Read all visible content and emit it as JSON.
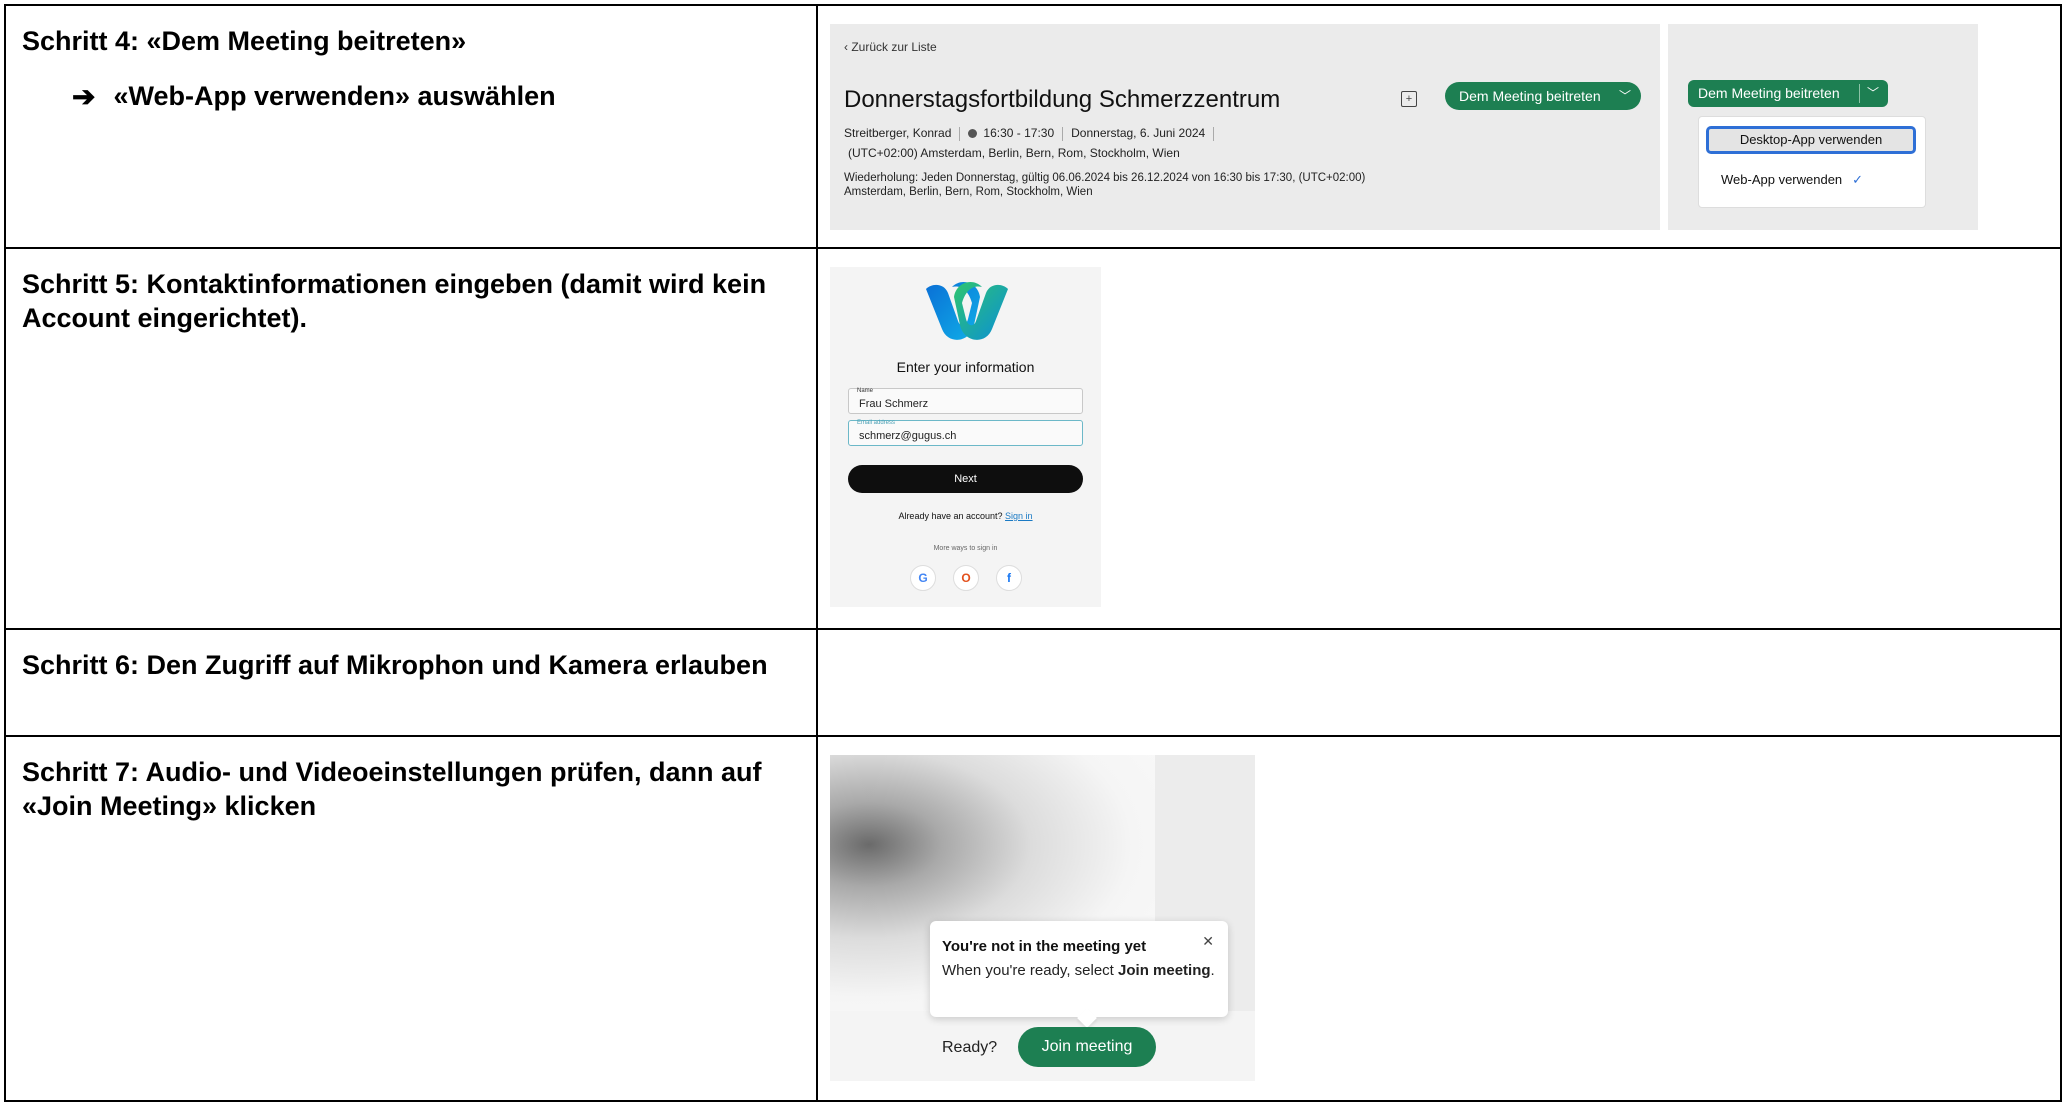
{
  "steps": {
    "step4": {
      "title": "Schritt 4: «Dem Meeting beitreten»",
      "arrow": "➔",
      "sub": "«Web-App verwenden» auswählen"
    },
    "step5": {
      "title": "Schritt 5: Kontaktinformationen eingeben (damit wird kein Account eingerichtet)."
    },
    "step6": {
      "title": "Schritt 6: Den Zugriff auf Mikrophon und Kamera erlauben"
    },
    "step7": {
      "title": "Schritt 7: Audio- und Videoeinstellungen prüfen, dann auf «Join Meeting» klicken"
    }
  },
  "meeting": {
    "back": "‹ Zurück zur Liste",
    "title": "Donnerstagsfortbildung Schmerzzentrum",
    "join_label": "Dem Meeting beitreten",
    "organizer": "Streitberger, Konrad",
    "time": "16:30 - 17:30",
    "date": "Donnerstag, 6. Juni 2024",
    "timezone": "(UTC+02:00) Amsterdam, Berlin, Bern, Rom, Stockholm, Wien",
    "recurrence1": "Wiederholung: Jeden Donnerstag, gültig 06.06.2024 bis 26.12.2024 von 16:30 bis 17:30, (UTC+02:00)",
    "recurrence2": "Amsterdam, Berlin, Bern, Rom, Stockholm, Wien"
  },
  "dropdown": {
    "join_label": "Dem Meeting beitreten",
    "option_desktop": "Desktop-App verwenden",
    "option_web": "Web-App verwenden"
  },
  "login": {
    "heading": "Enter your information",
    "name_label": "Name",
    "name_value": "Frau Schmerz",
    "email_label": "Email address",
    "email_value": "schmerz@gugus.ch",
    "next": "Next",
    "already": "Already have an account?",
    "sign_in": "Sign in",
    "more_ways": "More ways to sign in",
    "sso": [
      "G",
      "O",
      "f"
    ]
  },
  "join": {
    "tip_title": "You're not in the meeting yet",
    "tip_text_1": "When you're ready, select",
    "tip_bold": "Join meeting",
    "tip_end": ".",
    "ready": "Ready?",
    "button": "Join meeting"
  },
  "colors": {
    "accent_green": "#1d7f52",
    "focus_blue": "#2e6fd6"
  }
}
